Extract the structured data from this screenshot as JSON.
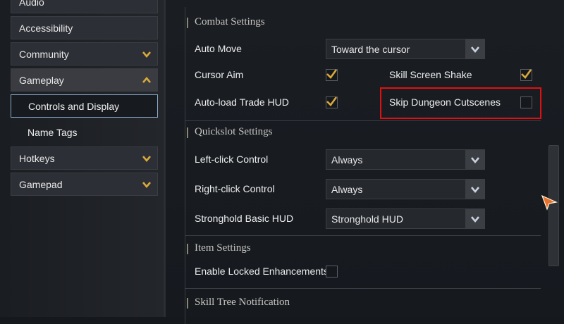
{
  "sidebar": {
    "items": [
      {
        "label": "Audio"
      },
      {
        "label": "Accessibility"
      },
      {
        "label": "Community"
      },
      {
        "label": "Gameplay"
      },
      {
        "label": "Controls and Display"
      },
      {
        "label": "Name Tags"
      },
      {
        "label": "Hotkeys"
      },
      {
        "label": "Gamepad"
      }
    ]
  },
  "combat": {
    "title": "Combat Settings",
    "auto_move_label": "Auto Move",
    "auto_move_value": "Toward the cursor",
    "cursor_aim_label": "Cursor Aim",
    "cursor_aim_checked": true,
    "skill_shake_label": "Skill Screen Shake",
    "skill_shake_checked": true,
    "autoload_label": "Auto-load Trade HUD",
    "autoload_checked": true,
    "skip_dungeon_label": "Skip Dungeon Cutscenes",
    "skip_dungeon_checked": false
  },
  "quickslot": {
    "title": "Quickslot Settings",
    "left_click_label": "Left-click Control",
    "left_click_value": "Always",
    "right_click_label": "Right-click Control",
    "right_click_value": "Always",
    "stronghold_label": "Stronghold Basic HUD",
    "stronghold_value": "Stronghold HUD"
  },
  "item": {
    "title": "Item Settings",
    "locked_label": "Enable Locked Enhancements",
    "locked_checked": false
  },
  "skilltree": {
    "title": "Skill Tree Notification"
  },
  "colors": {
    "accent_gold": "#d9a93b",
    "highlight_red": "#e01010"
  }
}
